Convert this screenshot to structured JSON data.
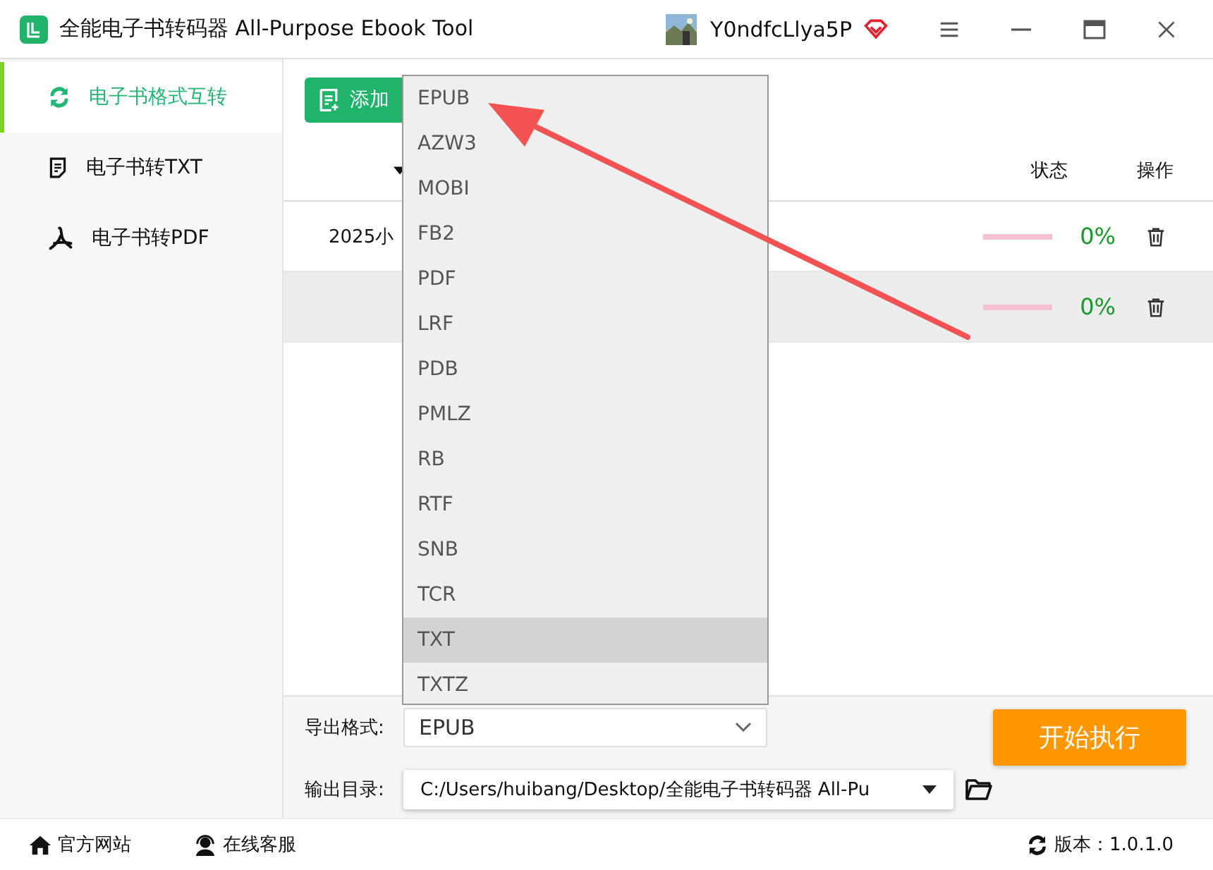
{
  "window": {
    "title": "全能电子书转码器 All-Purpose Ebook Tool",
    "user": "Y0ndfcLlya5P"
  },
  "sidebar": {
    "items": [
      {
        "label": "电子书格式互转",
        "selected": true
      },
      {
        "label": "电子书转TXT",
        "selected": false
      },
      {
        "label": "电子书转PDF",
        "selected": false
      }
    ]
  },
  "toolbar": {
    "add_button": "添加"
  },
  "table": {
    "columns": [
      "",
      "",
      "状态",
      "操作"
    ],
    "rows": [
      {
        "name": "2025小",
        "level": 0,
        "percent": "0%",
        "selected": false
      },
      {
        "level": 0,
        "percent": "0%",
        "selected": true
      }
    ]
  },
  "format_dropdown": {
    "options": [
      {
        "label": "EPUB",
        "selected": false
      },
      {
        "label": "AZW3",
        "selected": false
      },
      {
        "label": "MOBI",
        "selected": false
      },
      {
        "label": "FB2",
        "selected": false
      },
      {
        "label": "PDF",
        "selected": false
      },
      {
        "label": "LRF",
        "selected": false
      },
      {
        "label": "PDB",
        "selected": false
      },
      {
        "label": "PMLZ",
        "selected": false
      },
      {
        "label": "RB",
        "selected": false
      },
      {
        "label": "RTF",
        "selected": false
      },
      {
        "label": "SNB",
        "selected": false
      },
      {
        "label": "TCR",
        "selected": false
      },
      {
        "label": "TXT",
        "selected": true
      },
      {
        "label": "TXTZ",
        "selected": false
      }
    ]
  },
  "settings": {
    "format_label": "导出格式:",
    "format_value": "EPUB",
    "dir_label": "输出目录:",
    "dir_value": "C:/Users/huibang/Desktop/全能电子书转码器 All-Pu",
    "start_button": "开始执行"
  },
  "annotation": {
    "kind": "arrow"
  },
  "footer": {
    "website": "官方网站",
    "support": "在线客服",
    "version": "版本：1.0.1.0"
  }
}
